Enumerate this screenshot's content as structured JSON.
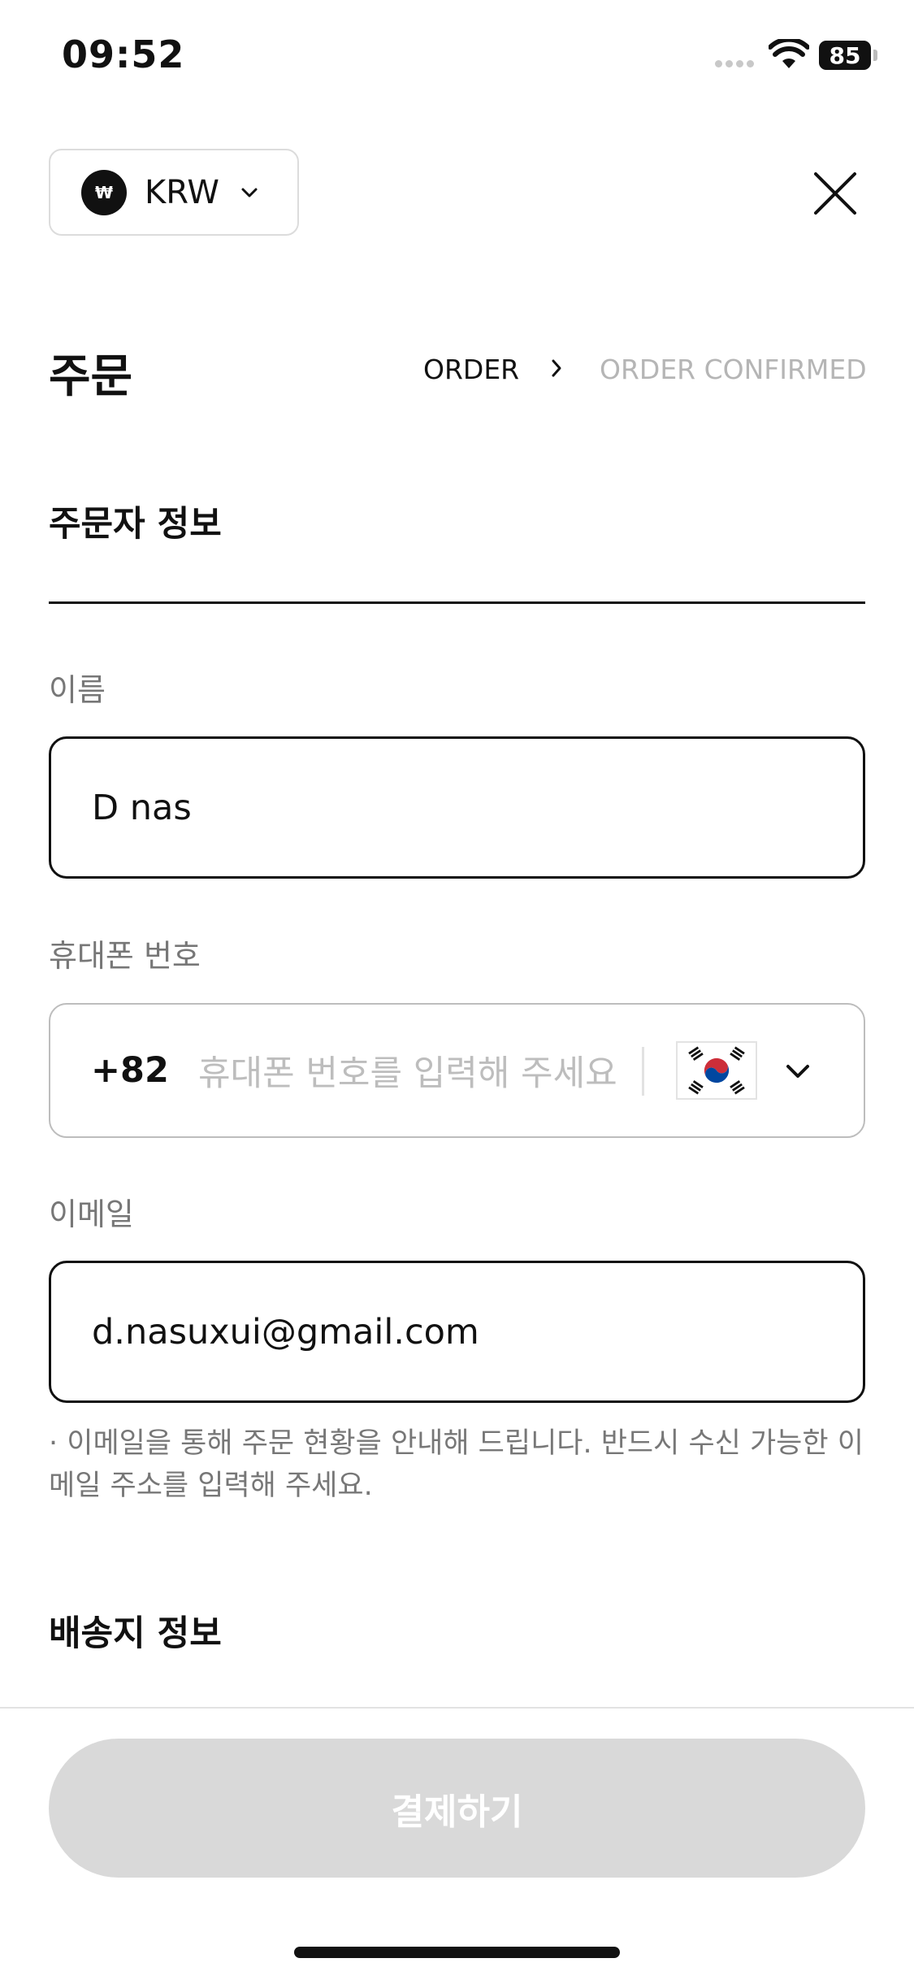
{
  "status_bar": {
    "time": "09:52",
    "battery": "85"
  },
  "currency": {
    "code": "KRW",
    "symbol": "₩",
    "icon": "won-icon"
  },
  "header": {
    "title": "주문",
    "steps": [
      {
        "label": "ORDER",
        "active": true
      },
      {
        "label": "ORDER CONFIRMED",
        "active": false
      }
    ]
  },
  "orderer_section": {
    "title": "주문자 정보",
    "name": {
      "label": "이름",
      "value": "D nas"
    },
    "phone": {
      "label": "휴대폰 번호",
      "country_code": "+82",
      "placeholder": "휴대폰 번호를 입력해 주세요",
      "country_flag": "south-korea-flag-icon"
    },
    "email": {
      "label": "이메일",
      "value": "d.nasuxui@gmail.com",
      "hint": "· 이메일을 통해 주문 현황을 안내해 드립니다. 반드시 수신 가능한 이메일 주소를 입력해 주세요."
    }
  },
  "shipping_section": {
    "title": "배송지 정보"
  },
  "footer": {
    "pay_label": "결제하기"
  },
  "colors": {
    "text": "#111111",
    "muted": "#777777",
    "placeholder": "#bdbdbd",
    "disabled_button": "#d9d9d9",
    "border_light": "#bdbdbd"
  }
}
